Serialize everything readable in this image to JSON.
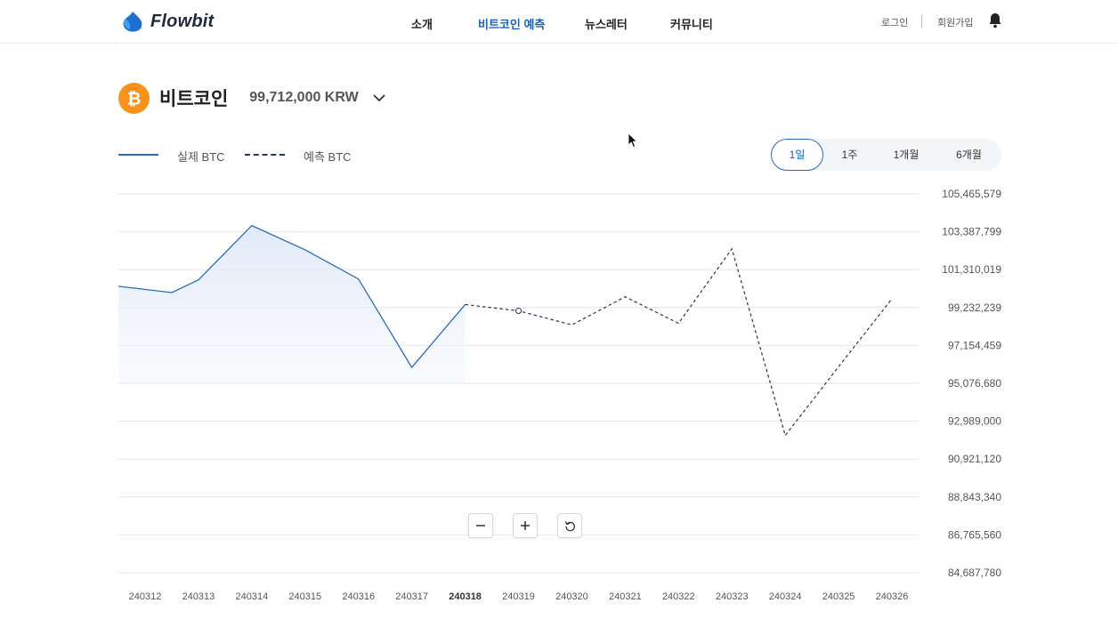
{
  "header": {
    "logo_text": "Flowbit",
    "nav": [
      {
        "label": "소개"
      },
      {
        "label": "비트코인 예측",
        "active": true
      },
      {
        "label": "뉴스레터"
      },
      {
        "label": "커뮤니티"
      }
    ],
    "login_label": "로그인",
    "signup_label": "회원가입",
    "bell_icon": "bell-icon"
  },
  "coin": {
    "name": "비트코인",
    "price": "99,712,000 KRW",
    "icon": "bitcoin-icon",
    "icon_color": "#f7931a"
  },
  "legend": {
    "actual_label": "실제 BTC",
    "predicted_label": "예측 BTC"
  },
  "period_tabs": [
    {
      "label": "1일",
      "active": true
    },
    {
      "label": "1주"
    },
    {
      "label": "1개월"
    },
    {
      "label": "6개월"
    }
  ],
  "zoom_controls": {
    "zoom_out_icon": "minus-icon",
    "zoom_in_icon": "plus-icon",
    "reset_icon": "reset-icon"
  },
  "colors": {
    "accent": "#1a62b8",
    "actual_line": "#2a6bb8",
    "predicted_line": "#243650",
    "area_fill": "#e8f0fb"
  },
  "chart_data": {
    "type": "line",
    "x": [
      "240312",
      "240313",
      "240314",
      "240315",
      "240316",
      "240317",
      "240318",
      "240319",
      "240320",
      "240321",
      "240322",
      "240323",
      "240324",
      "240325",
      "240326"
    ],
    "highlight_x": "240318",
    "y_ticks": [
      "105,465,579",
      "103,387,799",
      "101,310,019",
      "99,232,239",
      "97,154,459",
      "95,076,680",
      "92,989,000",
      "90,921,120",
      "88,843,340",
      "86,765,560",
      "84,687,780"
    ],
    "ylim": [
      84687780,
      105465579
    ],
    "y_axis_position": "right",
    "grid": true,
    "legend_placement": "top-left",
    "series": [
      {
        "name": "실제 BTC",
        "style": "solid",
        "area": true,
        "points": [
          {
            "x": "240312",
            "y": 100400000
          },
          {
            "x": "240312.5",
            "y": 100050000
          },
          {
            "x": "240313",
            "y": 100750000
          },
          {
            "x": "240314",
            "y": 103730000
          },
          {
            "x": "240315",
            "y": 102400000
          },
          {
            "x": "240316",
            "y": 100800000
          },
          {
            "x": "240317",
            "y": 95950000
          },
          {
            "x": "240318",
            "y": 99400000
          }
        ]
      },
      {
        "name": "예측 BTC",
        "style": "dashed",
        "marker_at": "240319",
        "points": [
          {
            "x": "240318",
            "y": 99400000
          },
          {
            "x": "240319",
            "y": 99050000
          },
          {
            "x": "240320",
            "y": 98280000
          },
          {
            "x": "240321",
            "y": 99820000
          },
          {
            "x": "240322",
            "y": 98370000
          },
          {
            "x": "240323",
            "y": 102450000
          },
          {
            "x": "240324",
            "y": 92220000
          },
          {
            "x": "240325",
            "y": 95990000
          },
          {
            "x": "240326",
            "y": 99710000
          }
        ]
      }
    ]
  }
}
